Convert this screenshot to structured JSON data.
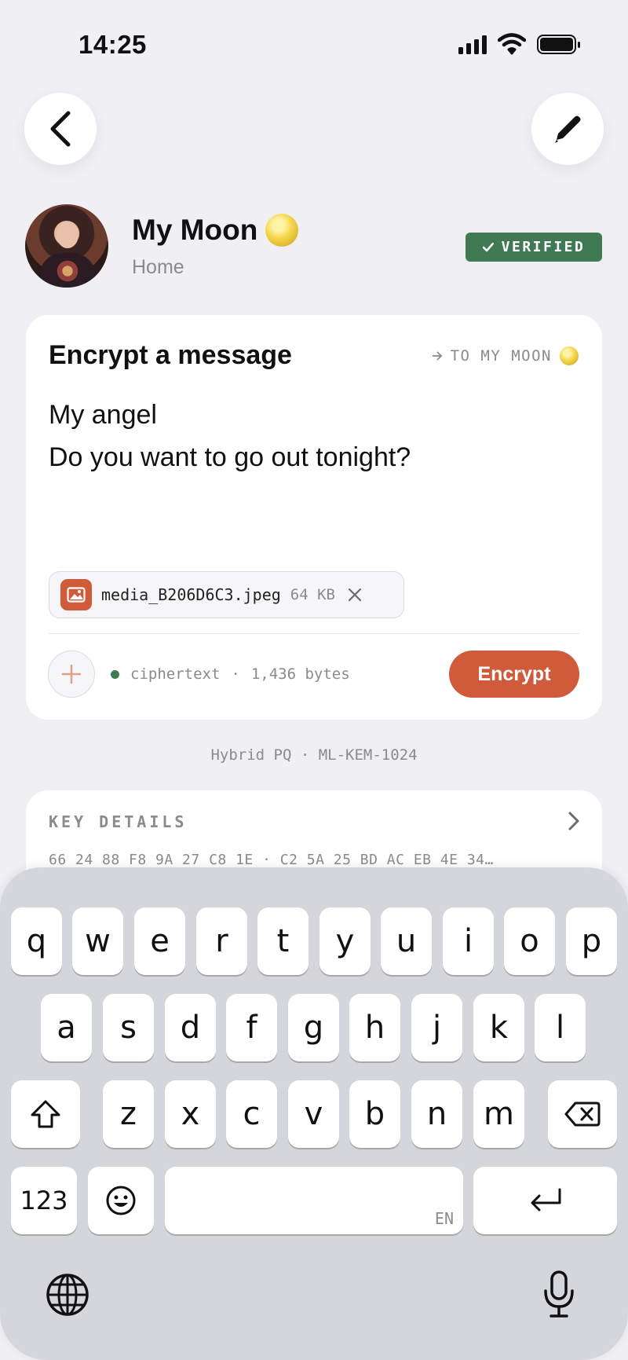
{
  "status_bar": {
    "time": "14:25"
  },
  "contact": {
    "name": "My Moon",
    "subtitle": "Home",
    "verified_label": "VERIFIED"
  },
  "composer": {
    "title": "Encrypt a message",
    "to_label": "TO MY MOON",
    "message_lines": [
      "My angel",
      "Do you want to go out tonight?"
    ],
    "attachment": {
      "filename": "media_B206D6C3.jpeg",
      "size": "64 KB"
    },
    "ciphertext_label": "ciphertext",
    "ciphertext_size": "1,436 bytes",
    "encrypt_label": "Encrypt"
  },
  "algorithm": "Hybrid PQ · ML-KEM-1024",
  "key_details": {
    "title": "KEY DETAILS",
    "fingerprint": "66 24 88 F8 9A 27 C8 1E · C2 5A 25 BD AC EB 4E 34…"
  },
  "keyboard": {
    "row1": [
      "q",
      "w",
      "e",
      "r",
      "t",
      "y",
      "u",
      "i",
      "o",
      "p"
    ],
    "row2": [
      "a",
      "s",
      "d",
      "f",
      "g",
      "h",
      "j",
      "k",
      "l"
    ],
    "row3": [
      "z",
      "x",
      "c",
      "v",
      "b",
      "n",
      "m"
    ],
    "numbers_label": "123",
    "space_lang": "EN"
  },
  "colors": {
    "accent": "#cf5b3b",
    "verified": "#3f7a55",
    "background": "#efeff4"
  },
  "icons": [
    "back-arrow-icon",
    "pencil-icon",
    "moon-emoji-icon",
    "checkmark-icon",
    "arrow-right-icon",
    "image-icon",
    "close-icon",
    "plus-icon",
    "chevron-right-icon",
    "shift-icon",
    "delete-icon",
    "emoji-icon",
    "return-icon",
    "globe-icon",
    "microphone-icon"
  ]
}
